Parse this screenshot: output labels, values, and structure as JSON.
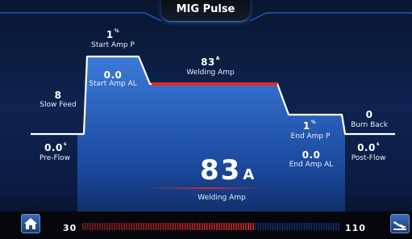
{
  "header": {
    "mode": "MIG Pulse"
  },
  "params": {
    "pre_flow": {
      "value": "0.0",
      "unit": "s",
      "label": "Pre-Flow"
    },
    "slow_feed": {
      "value": "8",
      "label": "Slow Feed"
    },
    "start_amp_p": {
      "value": "1",
      "unit": "%",
      "label": "Start Amp P"
    },
    "start_amp_al": {
      "value": "0.0",
      "label": "Start Amp AL"
    },
    "welding_amp": {
      "value": "83",
      "unit": "A",
      "label": "Welding Amp"
    },
    "end_amp_p": {
      "value": "1",
      "unit": "%",
      "label": "End Amp P"
    },
    "end_amp_al": {
      "value": "0.0",
      "label": "End Amp AL"
    },
    "burn_back": {
      "value": "0",
      "label": "Burn Back"
    },
    "post_flow": {
      "value": "0.0",
      "unit": "s",
      "label": "Post-Flow"
    }
  },
  "main_display": {
    "value": "83",
    "unit": "A",
    "label": "Welding Amp"
  },
  "meter": {
    "min": "30",
    "max": "110",
    "current": 83,
    "range": [
      30,
      110
    ]
  },
  "icons": {
    "left": "home-icon",
    "right": "welder-torch-icon"
  },
  "colors": {
    "accent_blue": "#2f6fd0",
    "active_red": "#e02b2b",
    "line_white": "#ffffff"
  }
}
